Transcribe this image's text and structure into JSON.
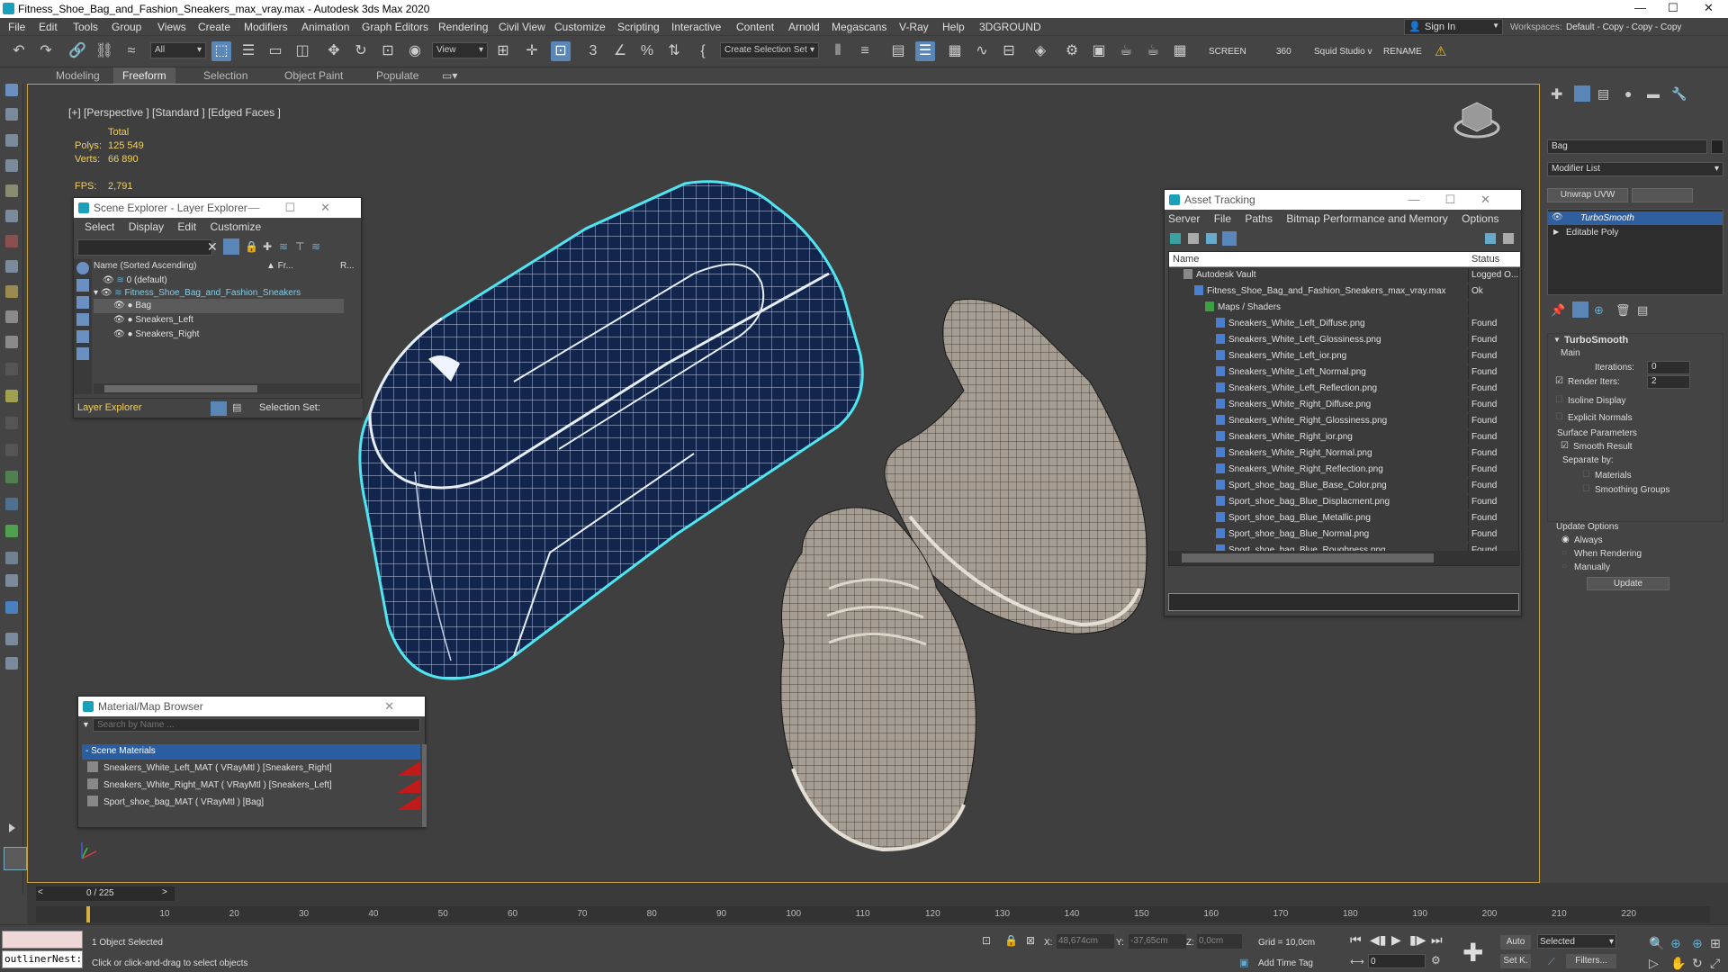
{
  "window": {
    "title": "Fitness_Shoe_Bag_and_Fashion_Sneakers_max_vray.max - Autodesk 3ds Max 2020",
    "controls": [
      "—",
      "☐",
      "✕"
    ]
  },
  "menu": {
    "items": [
      "File",
      "Edit",
      "Tools",
      "Group",
      "Views",
      "Create",
      "Modifiers",
      "Animation",
      "Graph Editors",
      "Rendering",
      "Civil View",
      "Customize",
      "Scripting",
      "Interactive",
      "Content",
      "Arnold",
      "Megascans",
      "V-Ray",
      "Help",
      "3DGROUND"
    ],
    "signin": "Sign In",
    "workspaces_label": "Workspaces:",
    "workspaces_value": "Default - Copy - Copy - Copy"
  },
  "toolbar": {
    "filter_value": "All",
    "view_value": "View",
    "selection_set": "Create Selection Set",
    "screen_label": "SCREEN",
    "value_360": "360",
    "squid_label": "Squid Studio v",
    "rename_label": "RENAME"
  },
  "ribbon": {
    "tabs": [
      "Modeling",
      "Freeform",
      "Selection",
      "Object Paint",
      "Populate"
    ],
    "active": "Freeform"
  },
  "viewport": {
    "label": "[+] [Perspective ] [Standard ] [Edged Faces ]",
    "total_label": "Total",
    "polys_label": "Polys:",
    "polys_value": "125 549",
    "verts_label": "Verts:",
    "verts_value": "66 890",
    "fps_label": "FPS:",
    "fps_value": "2,791"
  },
  "scene_explorer": {
    "title": "Scene Explorer - Layer Explorer",
    "menu": [
      "Select",
      "Display",
      "Edit",
      "Customize"
    ],
    "col_name": "Name (Sorted Ascending)",
    "col_fr": "▲ Fr...",
    "col_r": "R...",
    "rows": [
      {
        "label": "0 (default)",
        "indent": 0
      },
      {
        "label": "Fitness_Shoe_Bag_and_Fashion_Sneakers",
        "indent": 0
      },
      {
        "label": "Bag",
        "indent": 1
      },
      {
        "label": "Sneakers_Left",
        "indent": 1
      },
      {
        "label": "Sneakers_Right",
        "indent": 1
      }
    ],
    "footer_explorer": "Layer Explorer",
    "footer_selection": "Selection Set:"
  },
  "asset_tracking": {
    "title": "Asset Tracking",
    "menu": [
      "Server",
      "File",
      "Paths",
      "Bitmap Performance and Memory",
      "Options"
    ],
    "col_name": "Name",
    "col_status": "Status",
    "rows": [
      {
        "name": "Autodesk Vault",
        "status": "Logged O...",
        "level": 0,
        "kind": "vault"
      },
      {
        "name": "Fitness_Shoe_Bag_and_Fashion_Sneakers_max_vray.max",
        "status": "Ok",
        "level": 1,
        "kind": "max"
      },
      {
        "name": "Maps / Shaders",
        "status": "",
        "level": 2,
        "kind": "folder"
      },
      {
        "name": "Sneakers_White_Left_Diffuse.png",
        "status": "Found",
        "level": 3,
        "kind": "file"
      },
      {
        "name": "Sneakers_White_Left_Glossiness.png",
        "status": "Found",
        "level": 3,
        "kind": "file"
      },
      {
        "name": "Sneakers_White_Left_ior.png",
        "status": "Found",
        "level": 3,
        "kind": "file"
      },
      {
        "name": "Sneakers_White_Left_Normal.png",
        "status": "Found",
        "level": 3,
        "kind": "file"
      },
      {
        "name": "Sneakers_White_Left_Reflection.png",
        "status": "Found",
        "level": 3,
        "kind": "file"
      },
      {
        "name": "Sneakers_White_Right_Diffuse.png",
        "status": "Found",
        "level": 3,
        "kind": "file"
      },
      {
        "name": "Sneakers_White_Right_Glossiness.png",
        "status": "Found",
        "level": 3,
        "kind": "file"
      },
      {
        "name": "Sneakers_White_Right_ior.png",
        "status": "Found",
        "level": 3,
        "kind": "file"
      },
      {
        "name": "Sneakers_White_Right_Normal.png",
        "status": "Found",
        "level": 3,
        "kind": "file"
      },
      {
        "name": "Sneakers_White_Right_Reflection.png",
        "status": "Found",
        "level": 3,
        "kind": "file"
      },
      {
        "name": "Sport_shoe_bag_Blue_Base_Color.png",
        "status": "Found",
        "level": 3,
        "kind": "file"
      },
      {
        "name": "Sport_shoe_bag_Blue_Displacment.png",
        "status": "Found",
        "level": 3,
        "kind": "file"
      },
      {
        "name": "Sport_shoe_bag_Blue_Metallic.png",
        "status": "Found",
        "level": 3,
        "kind": "file"
      },
      {
        "name": "Sport_shoe_bag_Blue_Normal.png",
        "status": "Found",
        "level": 3,
        "kind": "file"
      },
      {
        "name": "Sport_shoe_bag_Blue_Roughness.png",
        "status": "Found",
        "level": 3,
        "kind": "file"
      }
    ]
  },
  "material_browser": {
    "title": "Material/Map Browser",
    "search_placeholder": "Search by Name ...",
    "group": "- Scene Materials",
    "items": [
      "Sneakers_White_Left_MAT  ( VRayMtl ) [Sneakers_Right]",
      "Sneakers_White_Right_MAT  ( VRayMtl ) [Sneakers_Left]",
      "Sport_shoe_bag_MAT  ( VRayMtl ) [Bag]"
    ]
  },
  "command_panel": {
    "object_name": "Bag",
    "modifier_list": "Modifier List",
    "unwrap_btn": "Unwrap UVW",
    "stack": [
      "TurboSmooth",
      "Editable Poly"
    ],
    "rollout_title": "TurboSmooth",
    "main_label": "Main",
    "iterations_label": "Iterations:",
    "iterations_value": "0",
    "render_iters_label": "Render Iters:",
    "render_iters_value": "2",
    "isoline": "Isoline Display",
    "explicit": "Explicit Normals",
    "surface_params": "Surface Parameters",
    "smooth_result": "Smooth Result",
    "separate_by": "Separate by:",
    "materials": "Materials",
    "smoothing_groups": "Smoothing Groups",
    "update_options": "Update Options",
    "always": "Always",
    "when_rendering": "When Rendering",
    "manually": "Manually",
    "update_btn": "Update"
  },
  "timeline": {
    "frame": "0 / 225",
    "ticks": [
      "10",
      "20",
      "30",
      "40",
      "50",
      "60",
      "70",
      "80",
      "90",
      "100",
      "110",
      "120",
      "130",
      "140",
      "150",
      "160",
      "170",
      "180",
      "190",
      "200",
      "210",
      "220"
    ]
  },
  "status": {
    "maxscript": "outlinerNest:",
    "selected": "1 Object Selected",
    "prompt": "Click or click-and-drag to select objects",
    "x_label": "X:",
    "x_value": "48,674cm",
    "y_label": "Y:",
    "y_value": "-37,65cm",
    "z_label": "Z:",
    "z_value": "0,0cm",
    "grid": "Grid = 10,0cm",
    "add_time_tag": "Add Time Tag",
    "auto": "Auto",
    "selected_dd": "Selected",
    "set_k": "Set K.",
    "filters": "Filters...",
    "frame_field": "0"
  }
}
